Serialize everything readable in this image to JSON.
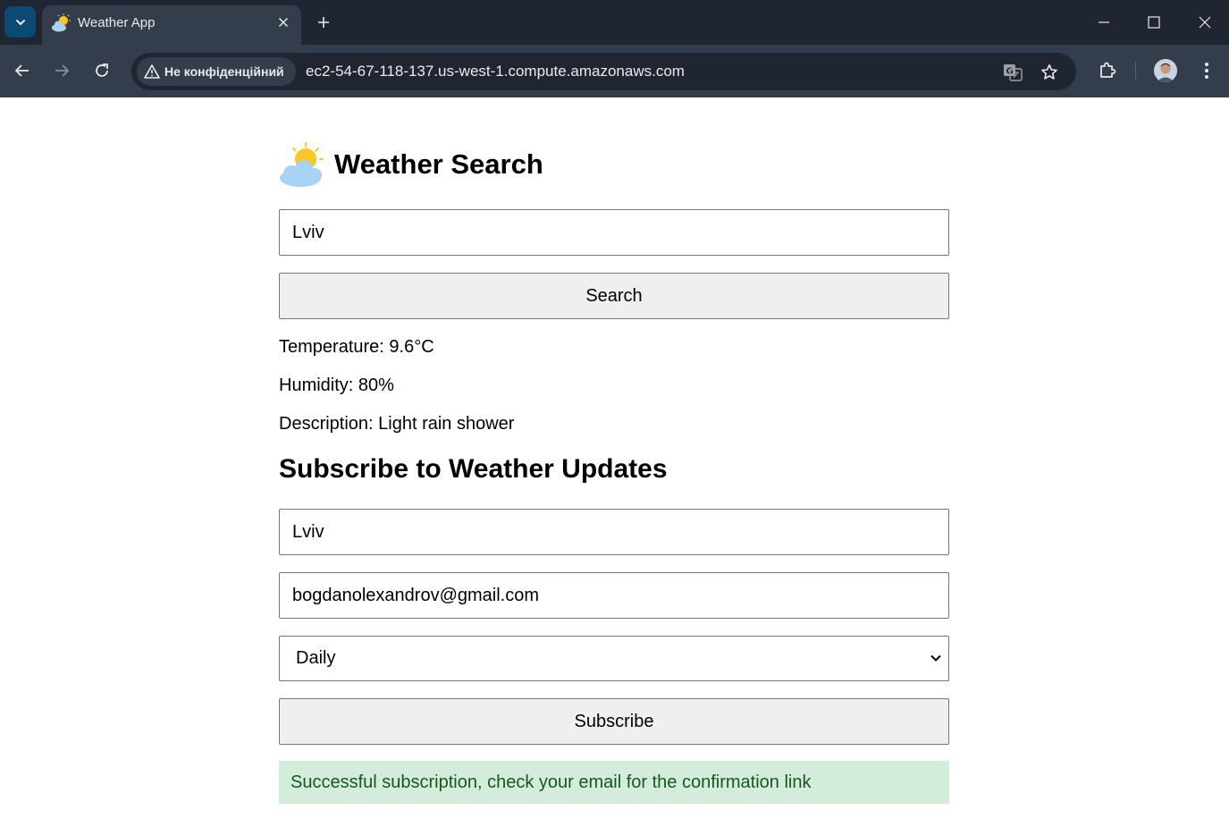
{
  "browser": {
    "tab_title": "Weather App",
    "security_label": "Не конфіденційний",
    "url": "ec2-54-67-118-137.us-west-1.compute.amazonaws.com"
  },
  "page": {
    "heading": "Weather Search",
    "search_input_value": "Lviv",
    "search_button_label": "Search",
    "temperature_text": "Temperature: 9.6°C",
    "humidity_text": "Humidity: 80%",
    "description_text": "Description: Light rain shower",
    "subscribe_heading": "Subscribe to Weather Updates",
    "subscribe_city_value": "Lviv",
    "subscribe_email_value": "bogdanolexandrov@gmail.com",
    "frequency_selected": "Daily",
    "subscribe_button_label": "Subscribe",
    "success_message": "Successful subscription, check your email for the confirmation link"
  },
  "colors": {
    "titlebar_bg": "#1f2632",
    "toolbar_bg": "#343d4b",
    "alert_bg": "#d4edda",
    "alert_text": "#155724",
    "button_bg": "#efefef"
  }
}
